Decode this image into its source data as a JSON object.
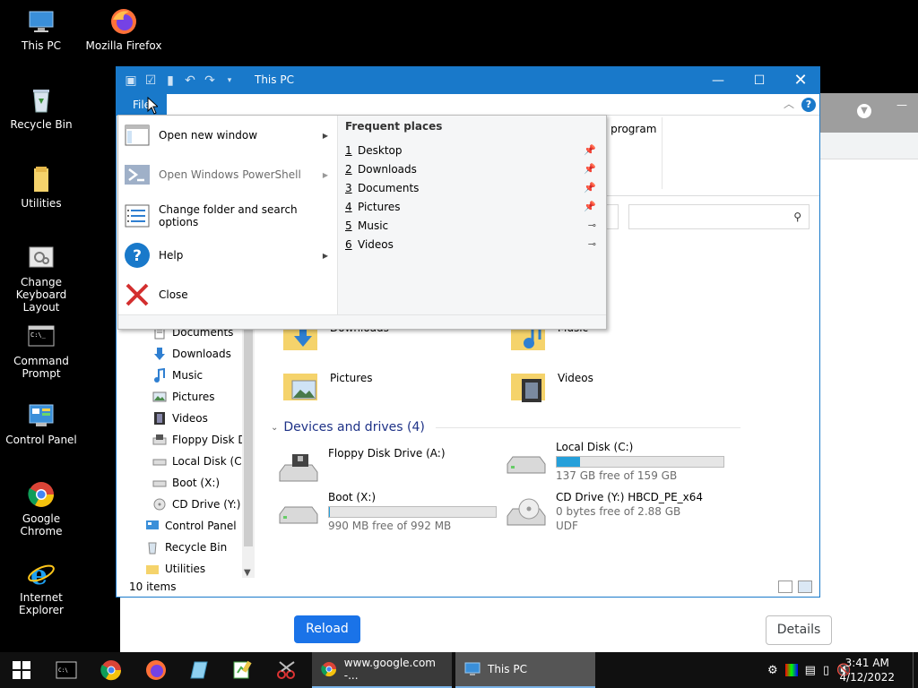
{
  "desktop": {
    "icons": [
      {
        "label": "This PC"
      },
      {
        "label": "Mozilla Firefox"
      },
      {
        "label": "Recycle Bin"
      },
      {
        "label": "Utilities"
      },
      {
        "label": "Change Keyboard Layout"
      },
      {
        "label": "Command Prompt"
      },
      {
        "label": "Control Panel"
      },
      {
        "label": "Google Chrome"
      },
      {
        "label": "Internet Explorer"
      }
    ]
  },
  "chrome_window": {
    "reload_label": "Reload",
    "details_label": "Details"
  },
  "explorer": {
    "title": "This PC",
    "file_tab": "File",
    "ribbon_partial": "a program",
    "nav_items": [
      "Documents",
      "Downloads",
      "Music",
      "Pictures",
      "Videos",
      "Floppy Disk Dri",
      "Local Disk (C:)",
      "Boot (X:)",
      "CD Drive (Y:) H",
      "Control Panel",
      "Recycle Bin",
      "Utilities"
    ],
    "folders": [
      "Downloads",
      "Music",
      "Pictures",
      "Videos"
    ],
    "devices_header": "Devices and drives (4)",
    "drives": [
      {
        "name": "Floppy Disk Drive (A:)",
        "free": "",
        "sub2": ""
      },
      {
        "name": "Local Disk (C:)",
        "free": "137 GB free of 159 GB",
        "used_fraction": 0.14
      },
      {
        "name": "Boot (X:)",
        "free": "990 MB free of 992 MB",
        "used_fraction": 0.002
      },
      {
        "name": "CD Drive (Y:) HBCD_PE_x64",
        "free": "0 bytes free of 2.88 GB",
        "sub2": "UDF"
      }
    ],
    "status": "10 items"
  },
  "file_menu": {
    "items": [
      {
        "label": "Open new window"
      },
      {
        "label": "Open Windows PowerShell"
      },
      {
        "label": "Change folder and search options"
      },
      {
        "label": "Help"
      },
      {
        "label": "Close"
      }
    ],
    "frequent_title": "Frequent places",
    "frequent": [
      {
        "num": "1",
        "label": "Desktop"
      },
      {
        "num": "2",
        "label": "Downloads"
      },
      {
        "num": "3",
        "label": "Documents"
      },
      {
        "num": "4",
        "label": "Pictures"
      },
      {
        "num": "5",
        "label": "Music"
      },
      {
        "num": "6",
        "label": "Videos"
      }
    ]
  },
  "taskbar": {
    "tasks": [
      {
        "label": "www.google.com -..."
      },
      {
        "label": "This PC"
      }
    ],
    "time": "3:41 AM",
    "date": "4/12/2022"
  },
  "colors": {
    "accent": "#1979ca",
    "chrome_blue": "#1a73e8",
    "drive_fill": "#26a0da",
    "taskbar": "#101010"
  }
}
